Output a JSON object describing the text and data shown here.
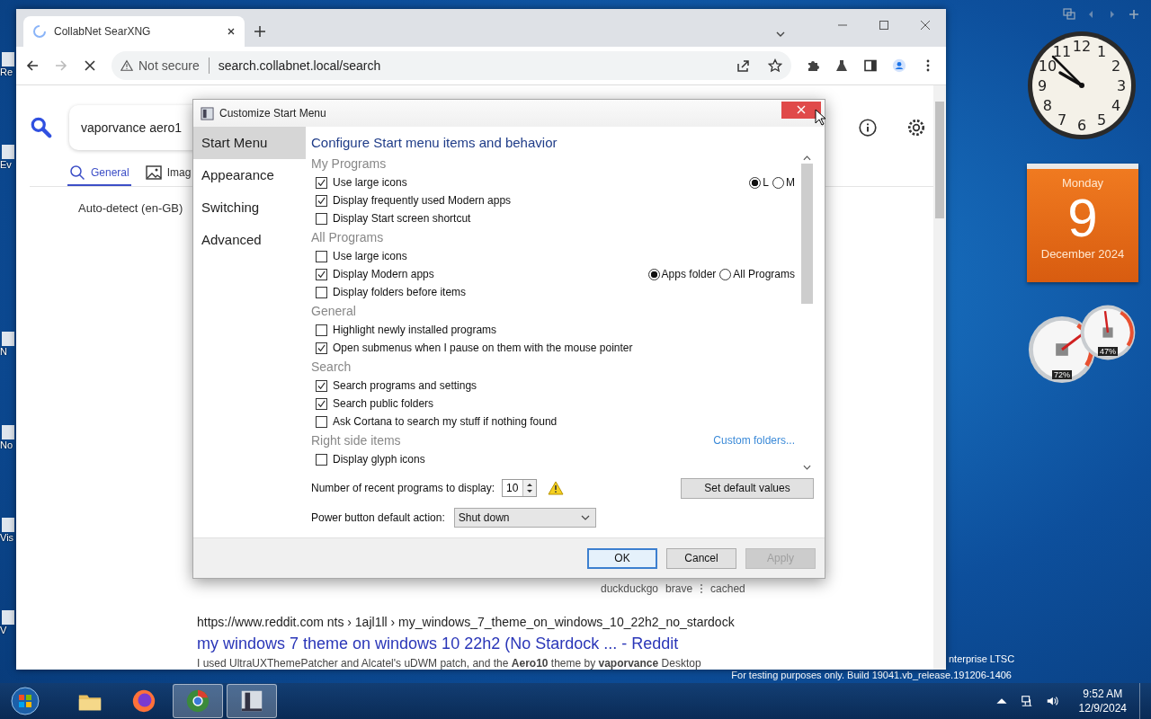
{
  "desktop": {
    "icon_labels": [
      "Re",
      "Ev",
      "N",
      "No",
      "Vis",
      "V"
    ],
    "watermark": [
      "nterprise LTSC",
      "For testing purposes only. Build 19041.vb_release.191206-1406"
    ]
  },
  "browser": {
    "tab": {
      "title": "CollabNet SearXNG",
      "loading": true
    },
    "security": "Not secure",
    "url": "search.collabnet.local/search",
    "page": {
      "query": "vaporvance aero1",
      "tabs": [
        {
          "label": "General",
          "selected": true
        },
        {
          "label": "Imag",
          "selected": false
        }
      ],
      "language": "Auto-detect (en-GB)",
      "result_links": [
        "duckduckgo",
        "brave",
        "cached"
      ],
      "result": {
        "url": "https://www.reddit.com  nts › 1ajl1ll › my_windows_7_theme_on_windows_10_22h2_no_stardock",
        "title": "my windows 7 theme on windows 10 22h2 (No Stardock ... - Reddit",
        "snippet": "I used UltraUXThemePatcher and Alcatel's uDWM patch, and the **Aero10** theme by **vaporvance** Desktop"
      }
    }
  },
  "dialog": {
    "title": "Customize Start Menu",
    "nav": [
      {
        "label": "Start Menu",
        "selected": true
      },
      {
        "label": "Appearance",
        "selected": false
      },
      {
        "label": "Switching",
        "selected": false
      },
      {
        "label": "Advanced",
        "selected": false
      }
    ],
    "heading": "Configure Start menu items and behavior",
    "groups": [
      {
        "title": "My Programs",
        "items": [
          {
            "label": "Use large icons",
            "checked": true,
            "options": [
              {
                "label": "L",
                "selected": true
              },
              {
                "label": "M",
                "selected": false
              }
            ]
          },
          {
            "label": "Display frequently used Modern apps",
            "checked": true
          },
          {
            "label": "Display Start screen shortcut",
            "checked": false
          }
        ]
      },
      {
        "title": "All Programs",
        "items": [
          {
            "label": "Use large icons",
            "checked": false
          },
          {
            "label": "Display Modern apps",
            "checked": true,
            "options": [
              {
                "label": "Apps folder",
                "selected": true
              },
              {
                "label": "All Programs",
                "selected": false
              }
            ]
          },
          {
            "label": "Display folders before items",
            "checked": false
          }
        ]
      },
      {
        "title": "General",
        "items": [
          {
            "label": "Highlight newly installed programs",
            "checked": false
          },
          {
            "label": "Open submenus when I pause on them with the mouse pointer",
            "checked": true
          }
        ]
      },
      {
        "title": "Search",
        "items": [
          {
            "label": "Search programs and settings",
            "checked": true
          },
          {
            "label": "Search public folders",
            "checked": true
          },
          {
            "label": "Ask Cortana to search my stuff if nothing found",
            "checked": false
          }
        ]
      },
      {
        "title": "Right side items",
        "link": "Custom folders...",
        "items": [
          {
            "label": "Display glyph icons",
            "checked": false
          }
        ]
      }
    ],
    "recent_label": "Number of recent programs to display:",
    "recent_value": "10",
    "default_button": "Set default values",
    "power_label": "Power button default action:",
    "power_value": "Shut down",
    "buttons": [
      {
        "label": "OK",
        "kind": "default"
      },
      {
        "label": "Cancel",
        "kind": "normal"
      },
      {
        "label": "Apply",
        "kind": "disabled"
      }
    ]
  },
  "gadgets": {
    "clock": {
      "numerals": [
        "12",
        "11",
        "1",
        "10",
        "2",
        "9",
        "3",
        "8",
        "4",
        "7",
        "5",
        "6"
      ]
    },
    "calendar": {
      "weekday": "Monday",
      "day": "9",
      "month": "December 2024"
    },
    "meters": [
      {
        "reading": "72%"
      },
      {
        "reading": "47%"
      }
    ]
  },
  "taskbar": {
    "apps": [
      {
        "kind": "explorer",
        "active": false
      },
      {
        "kind": "firefox",
        "active": false
      },
      {
        "kind": "chrome",
        "active": true
      },
      {
        "kind": "app",
        "active": true
      }
    ],
    "time": "9:52 AM",
    "date": "12/9/2024"
  }
}
